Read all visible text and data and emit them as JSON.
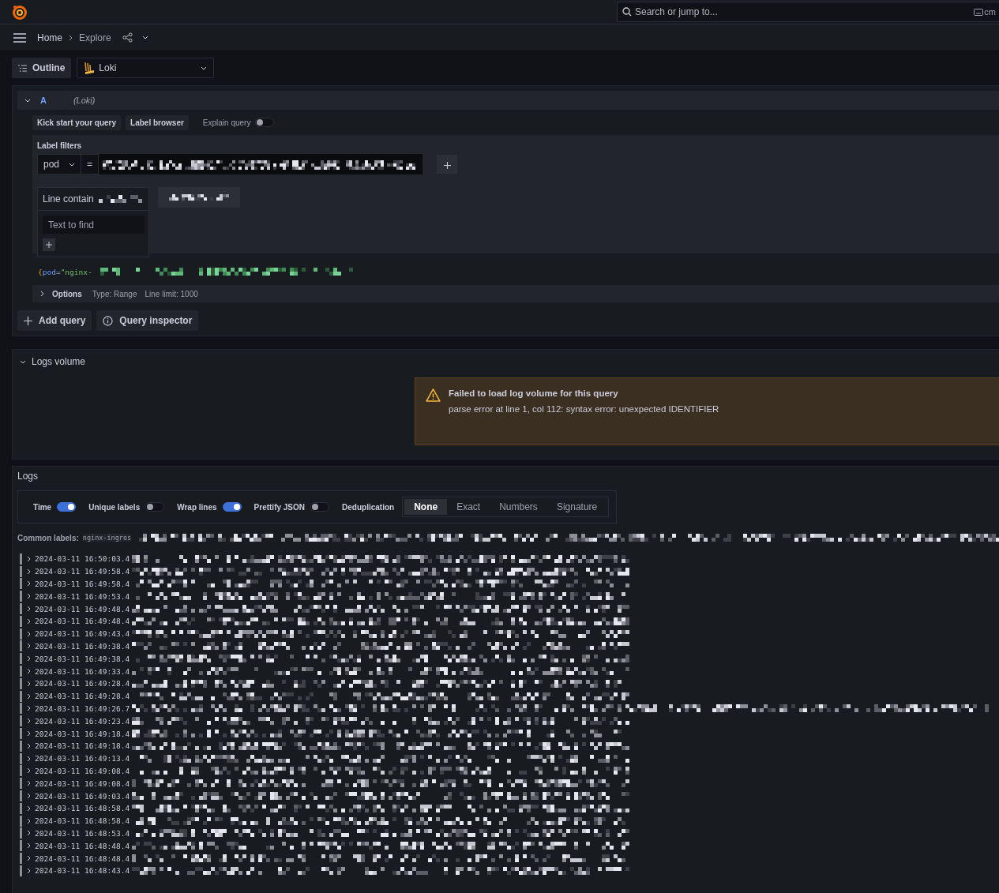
{
  "topbar": {
    "search": {
      "placeholder": "Search or jump to..."
    },
    "shortcut": "cm"
  },
  "breadcrumbs": [
    {
      "label": "Home"
    },
    {
      "label": "Explore"
    }
  ],
  "toolbar": {
    "outline_button": "Outline",
    "datasource": "Loki"
  },
  "query": {
    "expanded": true,
    "ref_id": "A",
    "datasource": "(Loki)",
    "buttons": [
      "Kick start your query",
      "Label browser"
    ],
    "explain_query": {
      "label": "Explain query",
      "on": false
    },
    "label_filters": {
      "title": "Label filters",
      "label": "pod",
      "operator": "="
    },
    "line_filter": {
      "title": "Line contain",
      "placeholder": "Text to find"
    },
    "code": {
      "brace": "{",
      "label": "pod",
      "operator": "=",
      "value": "\"nginx-"
    },
    "options": {
      "expanded": false,
      "label": "Options",
      "type": "Type: Range",
      "line_limit": "Line limit: 1000"
    }
  },
  "query_actions": [
    {
      "kind": "add",
      "label": "Add query"
    },
    {
      "kind": "inspect",
      "label": "Query inspector"
    }
  ],
  "logs_volume": {
    "expanded": true,
    "title": "Logs volume",
    "alert": {
      "title": "Failed to load log volume for this query",
      "message": "parse error at line 1, col 112: syntax error: unexpected IDENTIFIER"
    }
  },
  "logs": {
    "title": "Logs",
    "toggles": [
      {
        "label": "Time",
        "on": true
      },
      {
        "label": "Unique labels",
        "on": false
      },
      {
        "label": "Wrap lines",
        "on": true
      },
      {
        "label": "Prettify JSON",
        "on": false
      }
    ],
    "dedup": {
      "label": "Deduplication",
      "options": [
        {
          "label": "None",
          "selected": true
        },
        {
          "label": "Exact",
          "selected": false
        },
        {
          "label": "Numbers",
          "selected": false
        },
        {
          "label": "Signature",
          "selected": false
        }
      ]
    },
    "common_labels": {
      "label": "Common labels:",
      "value": "nginx-ingres"
    },
    "rows": [
      {
        "time": "2024-03-11 16:50:03.4"
      },
      {
        "time": "2024-03-11 16:49:58.4"
      },
      {
        "time": "2024-03-11 16:49:58.4"
      },
      {
        "time": "2024-03-11 16:49:53.4"
      },
      {
        "time": "2024-03-11 16:49:48.4"
      },
      {
        "time": "2024-03-11 16:49:48.4"
      },
      {
        "time": "2024-03-11 16:49:43.4"
      },
      {
        "time": "2024-03-11 16:49:38.4"
      },
      {
        "time": "2024-03-11 16:49:38.4"
      },
      {
        "time": "2024-03-11 16:49:33.4"
      },
      {
        "time": "2024-03-11 16:49:28.4"
      },
      {
        "time": "2024-03-11 16:49:28.4"
      },
      {
        "time": "2024-03-11 16:49:26.7"
      },
      {
        "time": "2024-03-11 16:49:23.4"
      },
      {
        "time": "2024-03-11 16:49:18.4"
      },
      {
        "time": "2024-03-11 16:49:18.4"
      },
      {
        "time": "2024-03-11 16:49:13.4"
      },
      {
        "time": "2024-03-11 16:49:08.4"
      },
      {
        "time": "2024-03-11 16:49:08.4"
      },
      {
        "time": "2024-03-11 16:49:03.4"
      },
      {
        "time": "2024-03-11 16:48:58.4"
      },
      {
        "time": "2024-03-11 16:48:58.4"
      },
      {
        "time": "2024-03-11 16:48:53.4"
      },
      {
        "time": "2024-03-11 16:48:48.4"
      },
      {
        "time": "2024-03-11 16:48:48.4"
      },
      {
        "time": "2024-03-11 16:48:43.4"
      }
    ]
  }
}
